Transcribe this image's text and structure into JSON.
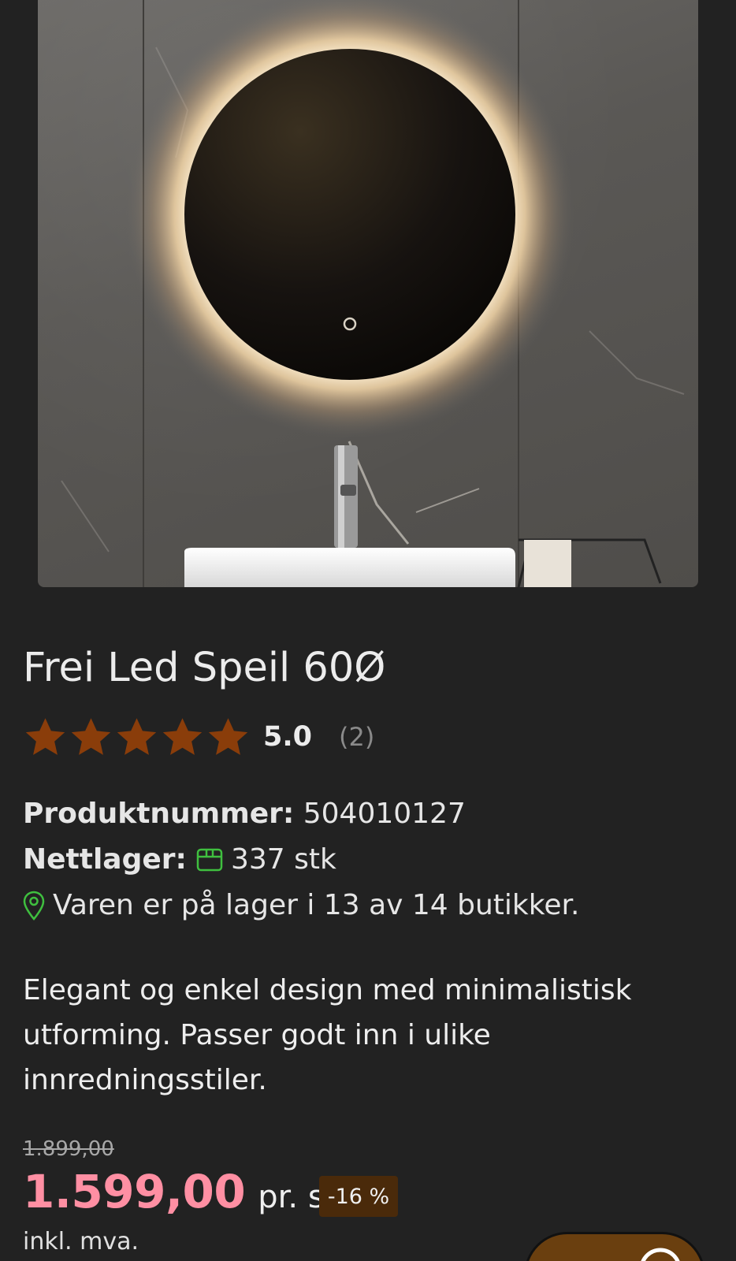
{
  "product": {
    "title": "Frei Led Speil 60Ø",
    "rating": {
      "score": "5.0",
      "count": "(2)",
      "stars": 5
    },
    "sku_label": "Produktnummer:",
    "sku_value": "504010127",
    "stock_label": "Nettlager:",
    "stock_value": "337 stk",
    "store_availability": "Varen er på lager i 13 av 14 butikker.",
    "description": "Elegant og enkel design med minimalistisk utforming. Passer godt inn i ulike innredningsstiler.",
    "old_price": "1.899,00",
    "price": "1.599,00",
    "unit": "pr. stk",
    "discount": "-16 %",
    "vat_note": "inkl. mva."
  },
  "colors": {
    "background": "#222222",
    "star": "#8a3d0a",
    "price": "#ff8fa3",
    "discount_badge": "#4a2a0a",
    "stock_icon": "#3fbf3f"
  },
  "icons": {
    "star": "star-icon",
    "stock": "box-icon",
    "store": "location-pin-icon",
    "chat": "chat-icon"
  }
}
